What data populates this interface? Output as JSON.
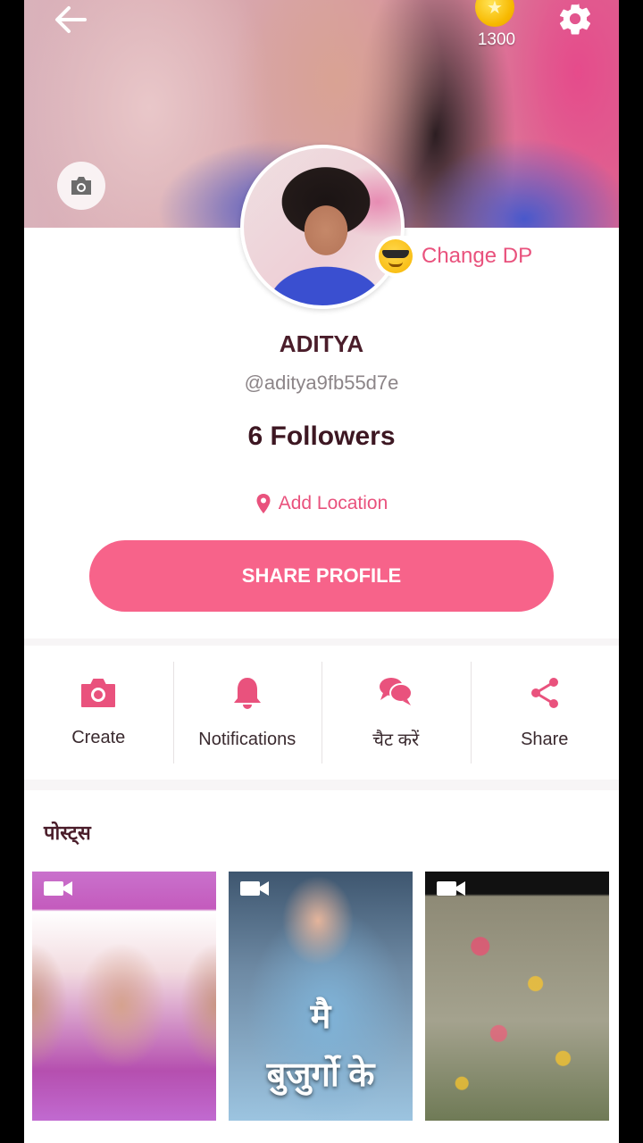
{
  "header": {
    "coins": "1300",
    "icons": [
      "back-arrow-icon",
      "coin-icon",
      "gear-icon",
      "camera-icon"
    ]
  },
  "profile": {
    "change_dp_label": "Change DP",
    "name": "ADITYA",
    "handle": "@aditya9fb55d7e",
    "followers": "6 Followers",
    "location_label": "Add Location",
    "share_button": "SHARE PROFILE"
  },
  "actions": [
    {
      "label": "Create",
      "icon": "camera-icon"
    },
    {
      "label": "Notifications",
      "icon": "bell-icon"
    },
    {
      "label": "चैट करें",
      "icon": "chat-icon"
    },
    {
      "label": "Share",
      "icon": "share-icon"
    }
  ],
  "posts": {
    "title": "पोस्ट्स",
    "items": [
      {
        "type": "video",
        "overlay_text": ""
      },
      {
        "type": "video",
        "overlay_text_line1": "मै",
        "overlay_text_line2": "बुजुर्गो के"
      },
      {
        "type": "video",
        "overlay_text": ""
      }
    ]
  },
  "colors": {
    "accent": "#f7638a",
    "accent_text": "#e9527d",
    "title_text": "#4a1d2a"
  }
}
